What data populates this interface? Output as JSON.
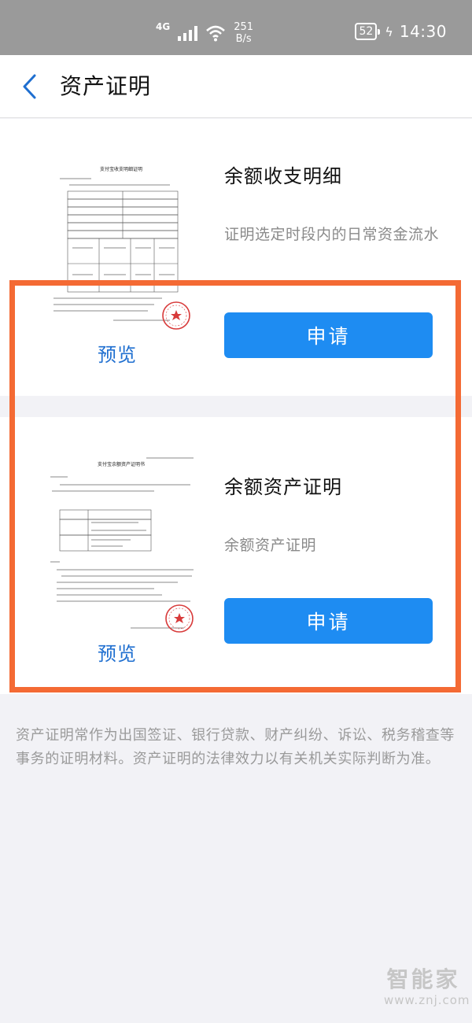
{
  "status_bar": {
    "network": "4G",
    "speed_value": "251",
    "speed_unit": "B/s",
    "battery": "52",
    "time": "14:30"
  },
  "header": {
    "back_icon": "chevron-left-icon",
    "title": "资产证明"
  },
  "cards": [
    {
      "title": "余额收支明细",
      "description": "证明选定时段内的日常资金流水",
      "preview_label": "预览",
      "apply_label": "申请",
      "thumbnail_heading": "支付宝收支明细证明"
    },
    {
      "title": "余额资产证明",
      "description": "余额资产证明",
      "preview_label": "预览",
      "apply_label": "申请",
      "thumbnail_heading": "支付宝余额资产证明书"
    }
  ],
  "footer_note": "资产证明常作为出国签证、银行贷款、财产纠纷、诉讼、税务稽查等事务的证明材料。资产证明的法律效力以有关机关实际判断为准。",
  "watermark": {
    "brand": "智能家",
    "url": "www.znj.com"
  },
  "colors": {
    "status_bar": "#9a9a9a",
    "accent": "#1e8cf2",
    "link": "#1f6fd0",
    "highlight": "#f46a34",
    "stamp": "#d83a3a"
  }
}
